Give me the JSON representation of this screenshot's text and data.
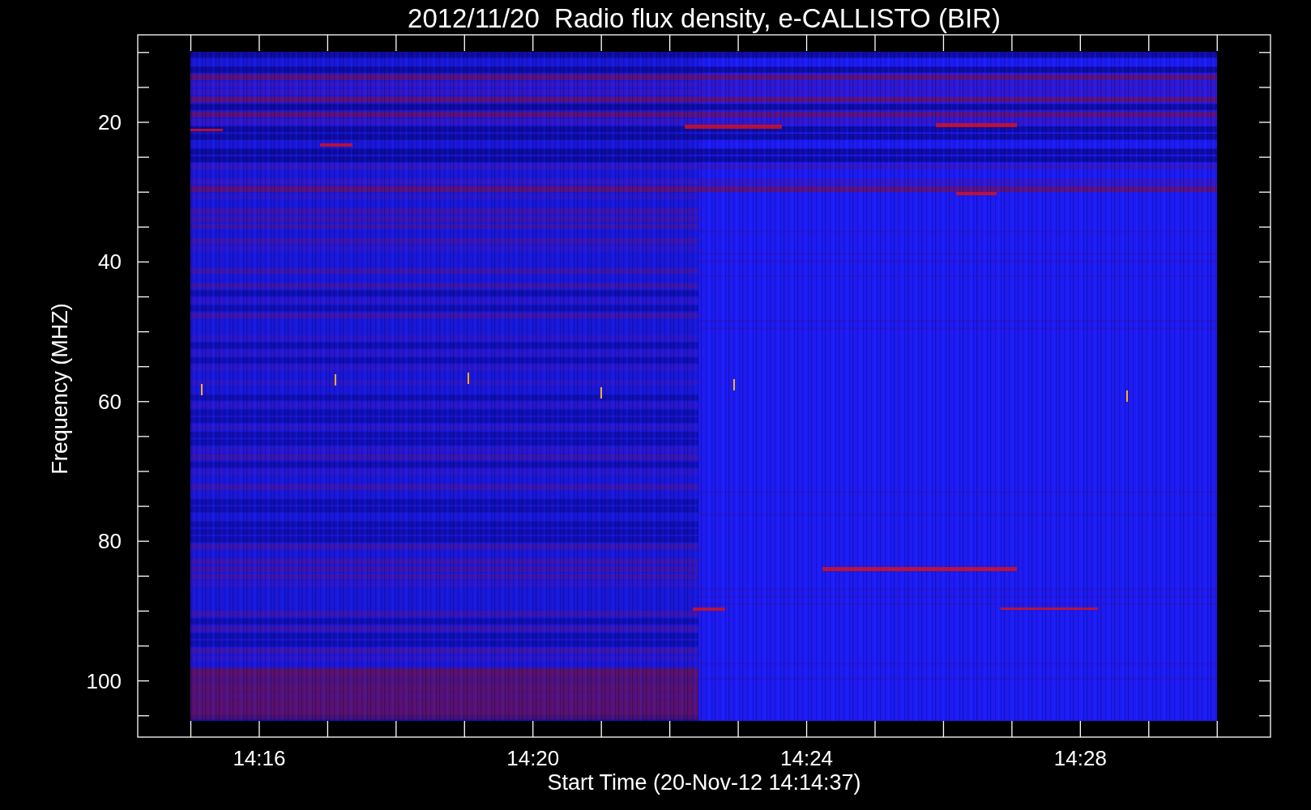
{
  "title": "2012/11/20  Radio flux density, e-CALLISTO (BIR)",
  "y_axis": {
    "label": "Frequency (MHZ)",
    "ticks": [
      "20",
      "40",
      "60",
      "80",
      "100"
    ]
  },
  "x_axis": {
    "label": "Start Time (20-Nov-12 14:14:37)",
    "ticks": [
      "14:16",
      "14:20",
      "14:24",
      "14:28"
    ]
  }
}
